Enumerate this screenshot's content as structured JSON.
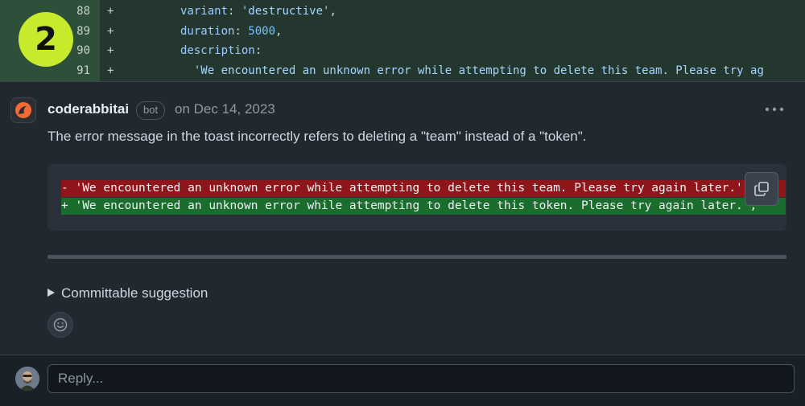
{
  "diff": {
    "step_badge": "2",
    "rows": [
      {
        "line": "88",
        "sign": "+",
        "key": "variant",
        "colon": ": ",
        "value": "'destructive'",
        "tail": ","
      },
      {
        "line": "89",
        "sign": "+",
        "key": "duration",
        "colon": ": ",
        "value": "5000",
        "tail": ","
      },
      {
        "line": "90",
        "sign": "+",
        "key": "description",
        "colon": ":",
        "value": "",
        "tail": ""
      },
      {
        "line": "91",
        "sign": "+",
        "key": "",
        "colon": "",
        "value": "  'We encountered an unknown error while attempting to delete this team. Please try ag",
        "tail": ""
      }
    ]
  },
  "comment": {
    "author": "coderabbitai",
    "bot_label": "bot",
    "date": "on Dec 14, 2023",
    "body": "The error message in the toast incorrectly refers to deleting a \"team\" instead of a \"token\".",
    "suggestion": {
      "removed": "- 'We encountered an unknown error while attempting to delete this team. Please try again later.',",
      "added": "+ 'We encountered an unknown error while attempting to delete this token. Please try again later.',"
    },
    "committable_label": "Committable suggestion"
  },
  "reply": {
    "placeholder": "Reply..."
  },
  "icons": {
    "more": "kebab-horizontal-icon",
    "copy": "copy-icon",
    "emoji": "smiley-icon",
    "expand": "triangle-right-icon"
  },
  "colors": {
    "badge": "#c8ea2c",
    "removed_bg": "#8e1519",
    "added_bg": "#1a6d2c"
  }
}
